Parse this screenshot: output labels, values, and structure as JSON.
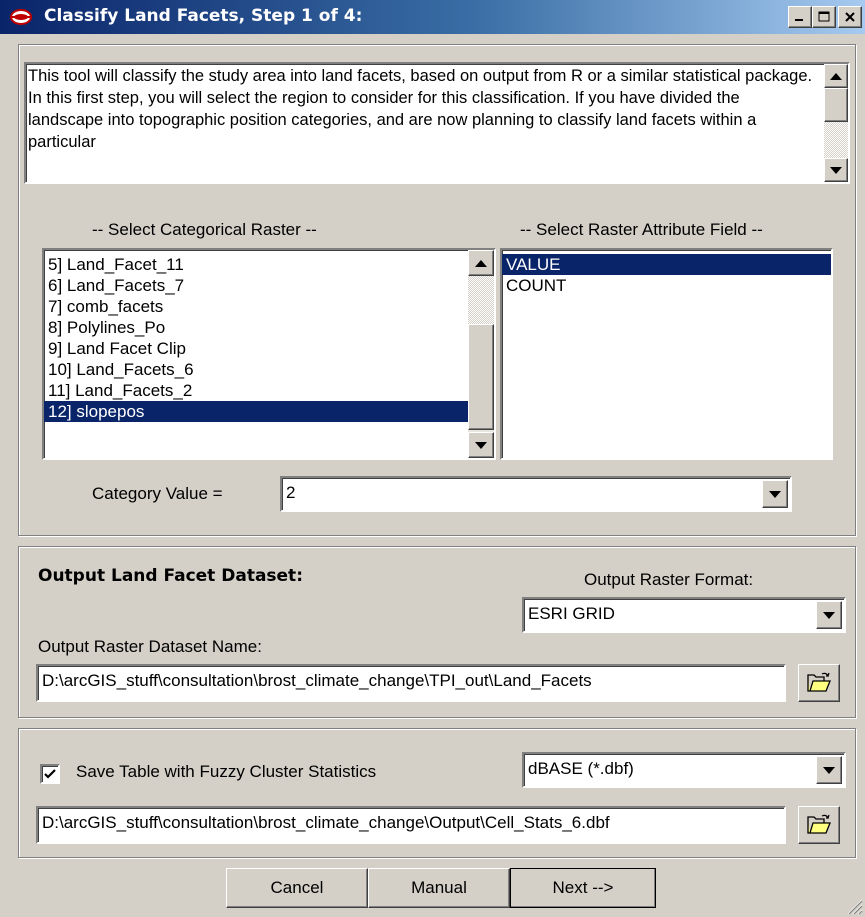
{
  "window": {
    "title": "Classify Land Facets, Step 1 of 4:"
  },
  "description": "This tool will classify the study area into land facets, based on output from R or a similar statistical package.  In this first step, you will select the region to consider for this classification.  If you have divided the landscape into topographic position categories, and are now planning to classify land facets within a particular",
  "raster_section": {
    "raster_header": "-- Select Categorical Raster --",
    "field_header": "-- Select Raster Attribute Field --",
    "rasters": [
      {
        "label": "5]  Land_Facet_11"
      },
      {
        "label": "6]  Land_Facets_7"
      },
      {
        "label": "7]  comb_facets"
      },
      {
        "label": "8]  Polylines_Po"
      },
      {
        "label": "9]  Land Facet Clip"
      },
      {
        "label": "10]  Land_Facets_6"
      },
      {
        "label": "11]  Land_Facets_2"
      },
      {
        "label": "12]  slopepos"
      }
    ],
    "selected_raster": "12]  slopepos",
    "fields": [
      {
        "label": "VALUE"
      },
      {
        "label": "COUNT"
      }
    ],
    "selected_field": "VALUE",
    "category_label": "Category Value =",
    "category_value": "2"
  },
  "output_section": {
    "heading": "Output Land Facet Dataset:",
    "format_label": "Output Raster Format:",
    "format_value": "ESRI GRID",
    "name_label": "Output Raster Dataset Name:",
    "name_value": "D:\\arcGIS_stuff\\consultation\\brost_climate_change\\TPI_out\\Land_Facets"
  },
  "stats_section": {
    "checkbox_label": "Save Table with Fuzzy Cluster Statistics",
    "checkbox_checked": true,
    "table_format": "dBASE (*.dbf)",
    "table_path": "D:\\arcGIS_stuff\\consultation\\brost_climate_change\\Output\\Cell_Stats_6.dbf"
  },
  "buttons": {
    "cancel": "Cancel",
    "manual": "Manual",
    "next": "Next -->"
  },
  "colors": {
    "title_bar": "#0a246a",
    "selection": "#0a246a",
    "face": "#d4d0c8"
  },
  "icons": {
    "app": "red-eye-icon",
    "minimize": "minimize-icon",
    "maximize": "maximize-icon",
    "close": "close-icon",
    "browse": "open-folder-icon",
    "check": "checkmark-icon",
    "resize": "size-grip-icon"
  }
}
